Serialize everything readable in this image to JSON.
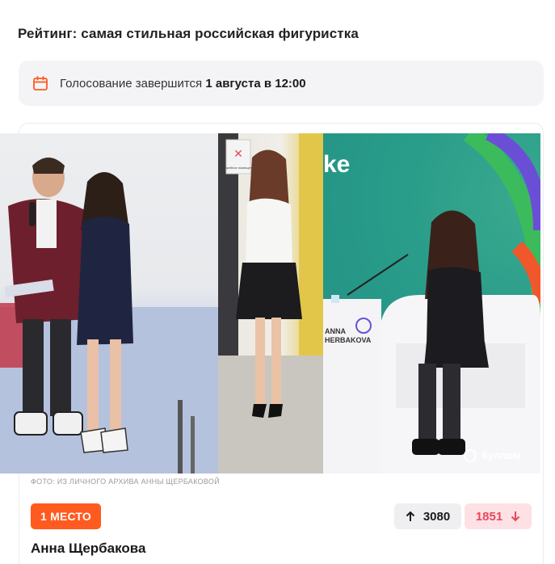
{
  "page": {
    "title": "Рейтинг: самая стильная российская фигуристка"
  },
  "voting": {
    "icon": "calendar-icon",
    "prefix": "Голосование завершится",
    "deadline": "1 августа в 12:00"
  },
  "entry": {
    "photo_caption": "ФОТО: ИЗ ЛИЧНОГО АРХИВА АННЫ ЩЕРБАКОВОЙ",
    "place_label": "1 МЕСТО",
    "upvotes": "3080",
    "downvotes": "1851",
    "name": "Анна Щербакова",
    "photo_texts": {
      "stand_left": "ANNA",
      "stand_right": "HERBAKOVA",
      "watermark": "буллом",
      "sign_top": "служебное помещение",
      "banner_letters": "ke"
    }
  },
  "colors": {
    "accent": "#ff5a1f",
    "up_bg": "#efeff1",
    "down_bg": "#fde1e4",
    "down_text": "#e8485c",
    "panel_bg": "#f4f4f6"
  }
}
